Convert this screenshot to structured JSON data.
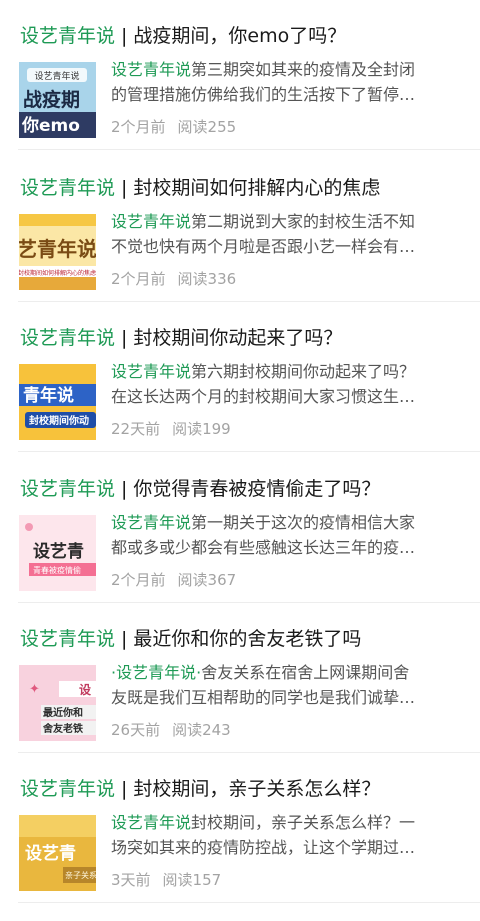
{
  "items": [
    {
      "source": "设艺青年说",
      "separator": "|",
      "headline": "战疫期间，你emo了吗？",
      "snippet_source": "设艺青年说",
      "snippet_line1": "第三期突如其来的疫情及全封闭",
      "snippet_line2": "的管理措施仿佛给我们的生活按下了暂停…",
      "time": "2个月前",
      "reads": "阅读255",
      "thumb_text1": "设艺青年说",
      "thumb_text2": "战疫期",
      "thumb_text3": "你emo"
    },
    {
      "source": "设艺青年说",
      "separator": "|",
      "headline": "封校期间如何排解内心的焦虑",
      "snippet_source": "设艺青年说",
      "snippet_line1": "第二期说到大家的封校生活不知",
      "snippet_line2": "不觉也快有两个月啦是否跟小艺一样会有…",
      "time": "2个月前",
      "reads": "阅读336",
      "thumb_text1": "艺青年说",
      "thumb_text2": "封校期间如何排解内心的焦虑"
    },
    {
      "source": "设艺青年说",
      "separator": "|",
      "headline": "封校期间你动起来了吗？",
      "snippet_source": "设艺青年说",
      "snippet_line1": "第六期封校期间你动起来了吗？",
      "snippet_line2": "在这长达两个月的封校期间大家习惯这生…",
      "time": "22天前",
      "reads": "阅读199",
      "thumb_text1": "青年说",
      "thumb_text2": "封校期间你动"
    },
    {
      "source": "设艺青年说",
      "separator": "|",
      "headline": "你觉得青春被疫情偷走了吗？",
      "snippet_source": "设艺青年说",
      "snippet_line1": "第一期关于这次的疫情相信大家",
      "snippet_line2": "都或多或少都会有些感触这长达三年的疫…",
      "time": "2个月前",
      "reads": "阅读367",
      "thumb_text1": "设艺青",
      "thumb_text2": "青春被疫情偷"
    },
    {
      "source": "设艺青年说",
      "separator": "|",
      "headline": "最近你和你的舍友老铁了吗",
      "snippet_source": "·设艺青年说·",
      "snippet_line1": "舍友关系在宿舍上网课期间舍",
      "snippet_line2": "友既是我们互相帮助的同学也是我们诚挚…",
      "time": "26天前",
      "reads": "阅读243",
      "thumb_text1": "设",
      "thumb_text2": "最近你和",
      "thumb_text3": "舍友老铁"
    },
    {
      "source": "设艺青年说",
      "separator": "|",
      "headline": "封校期间，亲子关系怎么样？",
      "snippet_source": "设艺青年说",
      "snippet_line1": "封校期间，亲子关系怎么样？一",
      "snippet_line2": "场突如其来的疫情防控战，让这个学期过…",
      "time": "3天前",
      "reads": "阅读157",
      "thumb_text1": "设艺青",
      "thumb_text2": "亲子关系"
    }
  ]
}
